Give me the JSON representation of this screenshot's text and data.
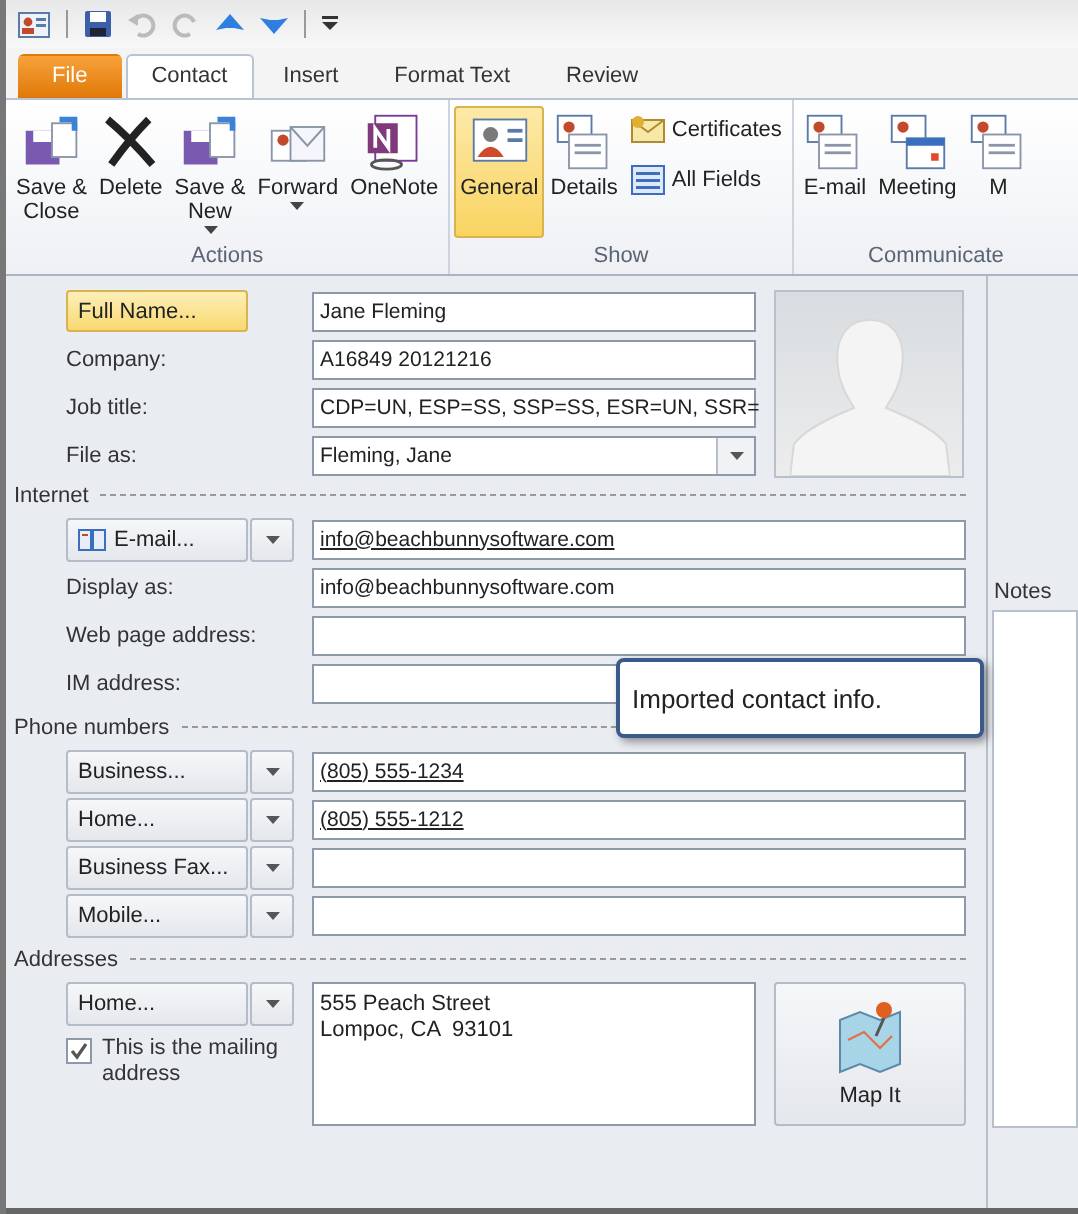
{
  "tabs": [
    {
      "label": "File",
      "kind": "file",
      "selected": false
    },
    {
      "label": "Contact",
      "kind": "tab",
      "selected": true
    },
    {
      "label": "Insert",
      "kind": "tab",
      "selected": false
    },
    {
      "label": "Format Text",
      "kind": "tab",
      "selected": false
    },
    {
      "label": "Review",
      "kind": "tab",
      "selected": false
    }
  ],
  "ribbon": [
    {
      "label": "Actions",
      "buttons": [
        {
          "lines": [
            "Save &",
            "Close"
          ],
          "dropdown": false,
          "selected": false,
          "kind": "large"
        },
        {
          "lines": [
            "Delete"
          ],
          "dropdown": false,
          "selected": false,
          "kind": "large"
        },
        {
          "lines": [
            "Save &",
            "New"
          ],
          "dropdown": true,
          "selected": false,
          "kind": "large"
        },
        {
          "lines": [
            "Forward"
          ],
          "dropdown": true,
          "selected": false,
          "kind": "large"
        },
        {
          "lines": [
            "OneNote"
          ],
          "dropdown": false,
          "selected": false,
          "kind": "large"
        }
      ]
    },
    {
      "label": "Show",
      "buttons": [
        {
          "lines": [
            "General"
          ],
          "dropdown": false,
          "selected": true,
          "kind": "large"
        },
        {
          "lines": [
            "Details"
          ],
          "dropdown": false,
          "selected": false,
          "kind": "large"
        },
        {
          "lines": [
            "Certificates"
          ],
          "selected": false,
          "kind": "small"
        },
        {
          "lines": [
            "All Fields"
          ],
          "selected": false,
          "kind": "small"
        }
      ]
    },
    {
      "label": "Communicate",
      "buttons": [
        {
          "lines": [
            "E-mail"
          ],
          "dropdown": false,
          "selected": false,
          "kind": "large"
        },
        {
          "lines": [
            "Meeting"
          ],
          "dropdown": false,
          "selected": false,
          "kind": "large"
        },
        {
          "lines": [
            "M"
          ],
          "dropdown": false,
          "selected": false,
          "kind": "large"
        }
      ]
    }
  ],
  "top_fields": [
    {
      "label": "Full Name...",
      "kind": "button",
      "value": "Jane Fleming"
    },
    {
      "label": "Company:",
      "kind": "label",
      "value": "A16849  20121216"
    },
    {
      "label": "Job title:",
      "kind": "label",
      "value": "CDP=UN, ESP=SS, SSP=SS, ESR=UN, SSR="
    },
    {
      "label": "File as:",
      "kind": "combo",
      "value": "Fleming, Jane"
    }
  ],
  "sections": [
    {
      "title": "Internet",
      "rows": [
        {
          "label": "E-mail...",
          "kind": "split",
          "value": "info@beachbunnysoftware.com",
          "link": true
        },
        {
          "label": "Display as:",
          "kind": "label",
          "value": "info@beachbunnysoftware.com",
          "link": false
        },
        {
          "label": "Web page address:",
          "kind": "label"
        },
        {
          "label": "IM address:",
          "kind": "label"
        }
      ]
    },
    {
      "title": "Phone numbers",
      "rows": [
        {
          "label": "Business...",
          "kind": "split",
          "value": "(805) 555-1234",
          "link": true
        },
        {
          "label": "Home...",
          "kind": "split",
          "value": "(805) 555-1212",
          "link": true
        },
        {
          "label": "Business Fax...",
          "kind": "split"
        },
        {
          "label": "Mobile...",
          "kind": "split"
        }
      ]
    }
  ],
  "addresses": {
    "title": "Addresses",
    "button": "Home...",
    "mailing_label": "This is the mailing address",
    "mailing_checked": true,
    "lines": [
      "555 Peach Street",
      "Lompoc, CA  93101"
    ],
    "map_button": "Map It"
  },
  "notes": {
    "label": "Notes"
  },
  "tooltip": "Imported contact info."
}
